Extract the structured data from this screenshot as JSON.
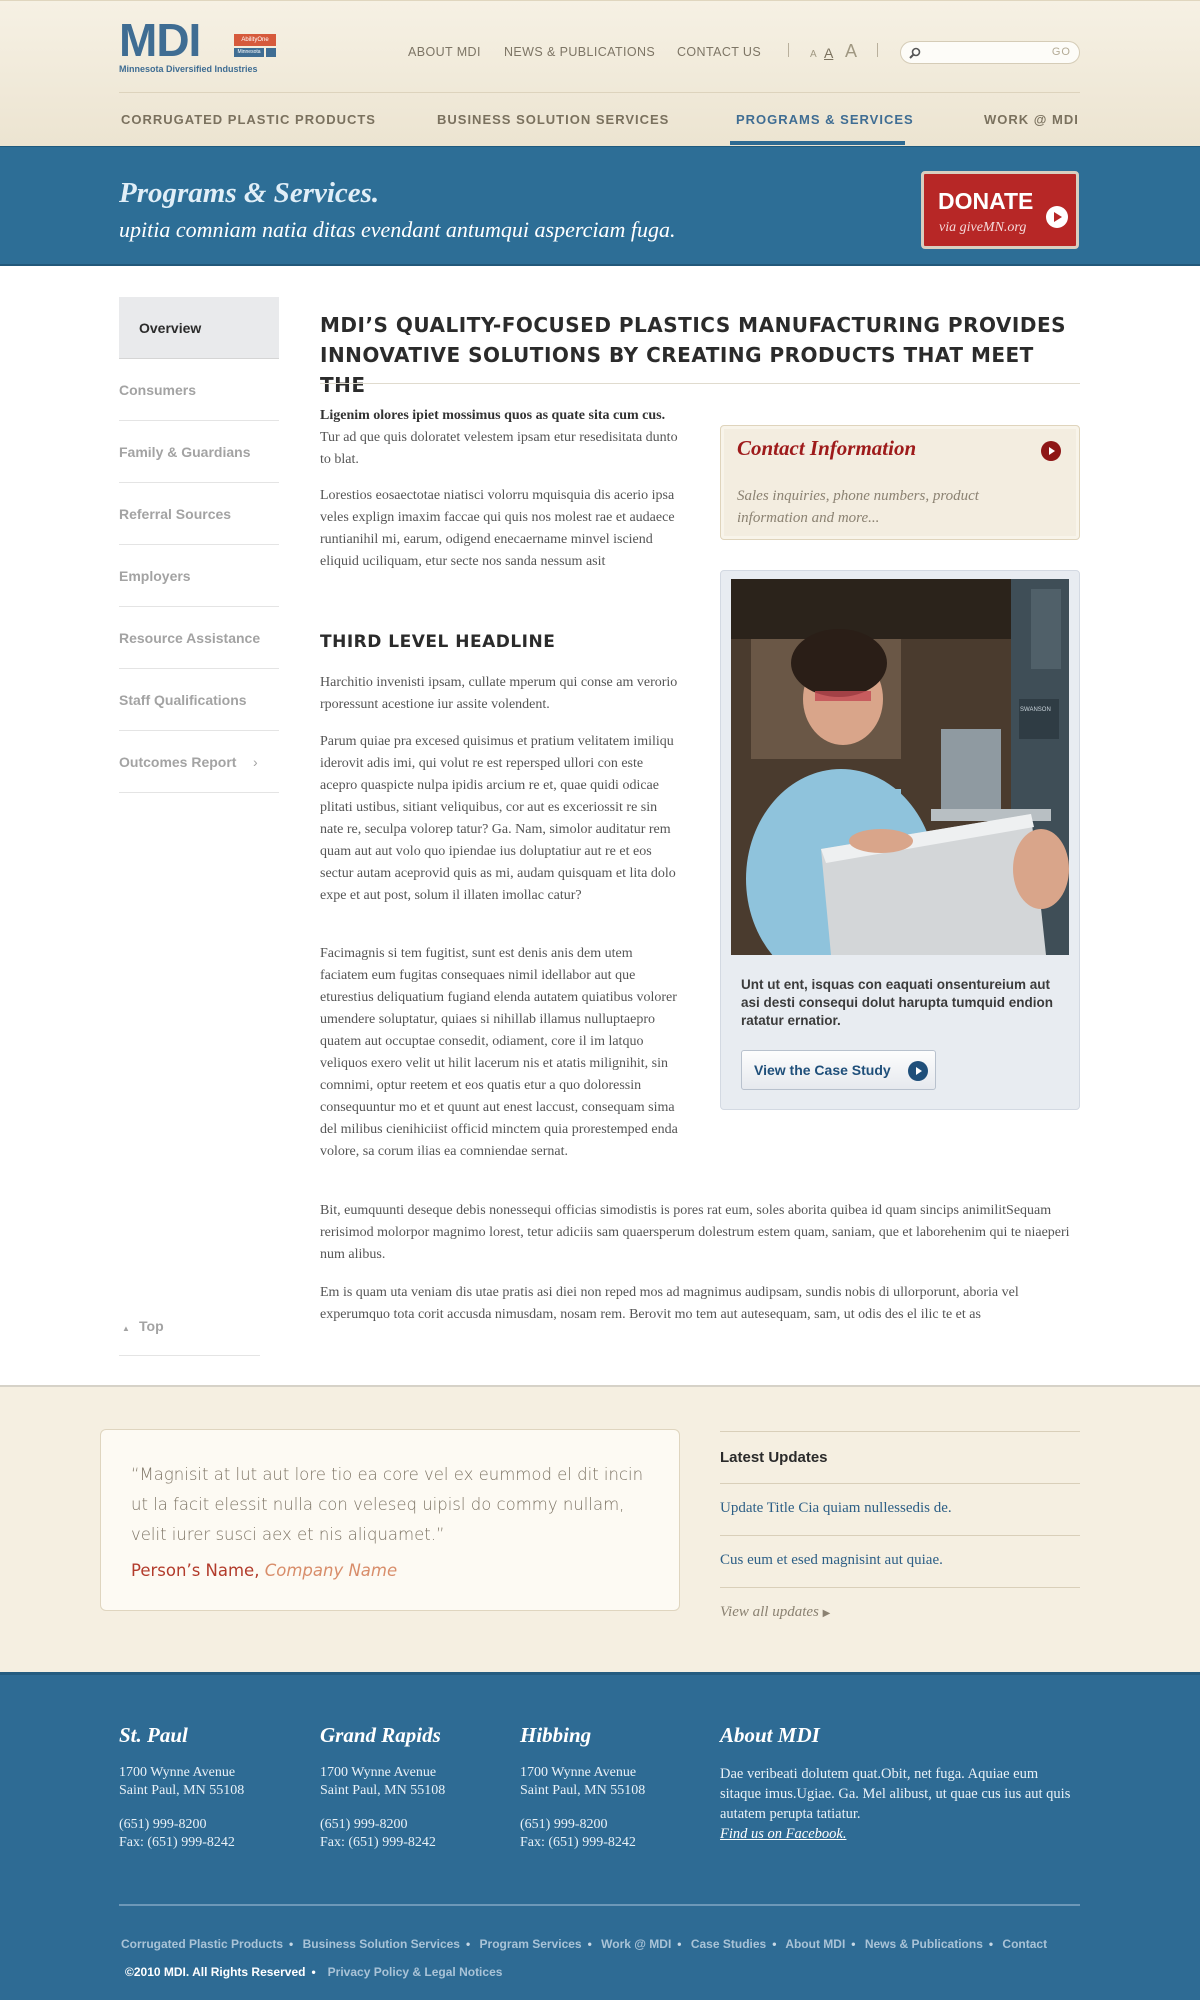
{
  "header": {
    "logo": {
      "mark": "MDI",
      "badge_top": "AbilityOne",
      "badge_bottom": "Minnesota",
      "subtitle": "Minnesota Diversified Industries"
    },
    "top_links": [
      "ABOUT MDI",
      "NEWS & PUBLICATIONS",
      "CONTACT US"
    ],
    "font_sizes": [
      "A",
      "A",
      "A"
    ],
    "search": {
      "placeholder": "",
      "button": "GO"
    },
    "main_nav": [
      {
        "label": "CORRUGATED PLASTIC PRODUCTS",
        "active": false
      },
      {
        "label": "BUSINESS SOLUTION SERVICES",
        "active": false
      },
      {
        "label": "PROGRAMS & SERVICES",
        "active": true
      },
      {
        "label": "WORK @ MDI",
        "active": false
      }
    ]
  },
  "banner": {
    "title": "Programs & Services.",
    "subtitle": "upitia comniam natia ditas evendant antumqui asperciam fuga.",
    "donate": {
      "label": "DONATE",
      "sub": "via giveMN.org"
    }
  },
  "sidebar": {
    "items": [
      "Overview",
      "Consumers",
      "Family & Guardians",
      "Referral Sources",
      "Employers",
      "Resource Assistance",
      "Staff Qualifications",
      "Outcomes Report"
    ],
    "active_index": 0,
    "top_label": "Top"
  },
  "main": {
    "headline": "MDI’S QUALITY-FOCUSED PLASTICS MANUFACTURING PROVIDES INNOVATIVE SOLUTIONS BY CREATING PRODUCTS THAT MEET THE",
    "intro_bold": "Ligenim olores ipiet mossimus quos as quate sita cum cus.",
    "intro_rest": " Tur ad que quis doloratet velestem ipsam etur resedisitata dunto to blat.",
    "p2": "Lorestios eosaectotae niatisci volorru mquisquia dis acerio ipsa veles explign imaxim faccae qui quis nos molest rae et audaece runtianihil mi, earum, odigend enecaername minvel isciend eliquid uciliquam, etur secte nos sanda nessum asit",
    "h3": "THIRD LEVEL HEADLINE",
    "p3": "Harchitio invenisti ipsam, cullate mperum qui conse am verorio rporessunt acestione iur assite volendent.",
    "p4": "Parum quiae pra excesed quisimus et pratium velitatem imiliqu iderovit adis imi, qui volut re est repersped ullori con este acepro quaspicte nulpa ipidis arcium re et, quae quidi odicae plitati ustibus, sitiant veliquibus, cor aut es exceriossit re sin nate re, seculpa volorep tatur? Ga. Nam, simolor auditatur rem quam aut aut volo quo ipiendae ius doluptatiur aut re et eos sectur autam aceprovid quis as mi, audam quisquam et lita dolo expe et aut post, solum il illaten imollac catur?",
    "p5": "Facimagnis si tem fugitist, sunt est denis anis dem utem faciatem eum fugitas consequaes nimil idellabor aut que eturestius deliquatium fugiand elenda autatem quiatibus volorer umendere soluptatur, quiaes si nihillab illamus nulluptaepro quatem aut occuptae consedit, odiament, core il im latquo veliquos exero velit ut hilit lacerum nis et atatis milignihit, sin comnimi, optur reetem et eos quatis etur a quo doloressin consequuntur mo et et quunt aut enest laccust, consequam sima del milibus cienihiciist officid minctem quia prorestemped enda volore, sa corum ilias ea comniendae sernat.",
    "p6": "Bit, eumquunti deseque debis nonessequi officias simodistis is pores rat eum, soles aborita quibea id quam sincips animilitSequam rerisimod molorpor magnimo lorest, tetur adiciis sam quaersperum dolestrum estem quam, saniam, que et laborehenim qui te niaeperi num alibus.",
    "p7": "Em is quam uta veniam dis utae pratis asi diei non reped mos ad magnimus audipsam, sundis nobis di ullorporunt, aboria vel experumquo tota corit accusda nimusdam, nosam rem. Berovit mo tem aut autesequam, sam, ut odis des el ilic te et as"
  },
  "contact_box": {
    "title": "Contact Information",
    "description": "Sales inquiries, phone numbers, product information and more..."
  },
  "case_study": {
    "caption": "Unt ut ent, isquas con eaquati onsentureium aut asi desti consequi dolut harupta tumquid endion ratatur ernatior.",
    "button": "View the Case Study",
    "machine_label": "SWANSON"
  },
  "testimonial": {
    "quote": "“Magnisit at lut aut lore tio ea core vel ex eummod el dit incin ut la facit elessit nulla con veleseq uipisl do commy nullam, velit iurer susci aex et nis aliquamet.”",
    "person": "Person’s Name,",
    "company": "Company Name"
  },
  "updates": {
    "heading": "Latest Updates",
    "items": [
      "Update Title Cia quiam nullessedis de.",
      "Cus eum et esed magnisint aut quiae."
    ],
    "view_all": "View all updates"
  },
  "footer": {
    "locations": [
      {
        "name": "St. Paul",
        "address1": "1700 Wynne Avenue",
        "address2": "Saint Paul, MN 55108",
        "phone": "(651) 999-8200",
        "fax": "Fax: (651) 999-8242"
      },
      {
        "name": "Grand Rapids",
        "address1": "1700 Wynne Avenue",
        "address2": "Saint Paul, MN 55108",
        "phone": "(651) 999-8200",
        "fax": "Fax: (651) 999-8242"
      },
      {
        "name": "Hibbing",
        "address1": "1700 Wynne Avenue",
        "address2": "Saint Paul, MN 55108",
        "phone": "(651) 999-8200",
        "fax": "Fax: (651) 999-8242"
      }
    ],
    "about": {
      "title": "About MDI",
      "text": "Dae veribeati dolutem quat.Obit, net fuga. Aquiae eum sitaque imus.Ugiae. Ga. Mel alibust, ut quae cus ius aut quis autatem perupta tatiatur.",
      "facebook": "Find us on Facebook."
    },
    "links": [
      "Corrugated Plastic Products",
      "Business Solution Services",
      "Program Services",
      "Work @ MDI",
      "Case Studies",
      "About MDI",
      "News & Publications",
      "Contact"
    ],
    "copyright": "©2010 MDI. All Rights Reserved",
    "privacy": "Privacy Policy & Legal Notices"
  },
  "colors": {
    "brand_blue": "#2e6b94",
    "donate_red": "#b72726",
    "cream": "#f5efe1",
    "contact_red": "#9e1b1b"
  },
  "icons": [
    "search-icon",
    "play-arrow-icon",
    "chevron-right-icon",
    "up-triangle-icon"
  ]
}
